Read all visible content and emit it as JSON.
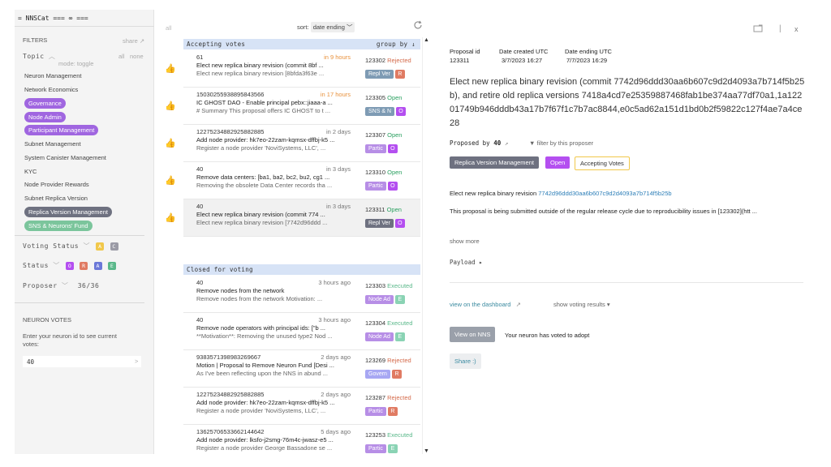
{
  "app": {
    "title": "= NNSCat === ∞ ==="
  },
  "filters": {
    "label": "FILTERS",
    "share": "share ↗",
    "topic_label": "Topic",
    "topic_chevron": "︿",
    "all": "all",
    "none": "none",
    "mode": "mode: toggle",
    "topics": [
      {
        "label": "Neuron Management",
        "selected": false
      },
      {
        "label": "Network Economics",
        "selected": false
      },
      {
        "label": "Governance",
        "selected": true,
        "color": "#a066e0"
      },
      {
        "label": "Node Admin",
        "selected": true,
        "color": "#a066e0"
      },
      {
        "label": "Participant Management",
        "selected": true,
        "color": "#a066e0"
      },
      {
        "label": "Subnet Management",
        "selected": false
      },
      {
        "label": "System Canister Management",
        "selected": false
      },
      {
        "label": "KYC",
        "selected": false
      },
      {
        "label": "Node Provider Rewards",
        "selected": false
      },
      {
        "label": "Subnet Replica Version",
        "selected": false
      },
      {
        "label": "Replica Version Management",
        "selected": true,
        "color": "#6e7180"
      },
      {
        "label": "SNS & Neurons' Fund",
        "selected": true,
        "color": "#7bc59c"
      }
    ],
    "voting_status": {
      "label": "Voting Status",
      "chevron": "﹀",
      "badges": [
        "A",
        "C"
      ]
    },
    "status": {
      "label": "Status",
      "chevron": "﹀",
      "badges": [
        "O",
        "R",
        "A",
        "E"
      ]
    },
    "proposer": {
      "label": "Proposer",
      "chevron": "﹀",
      "count": "36/36"
    }
  },
  "neuron_votes": {
    "label": "NEURON VOTES",
    "help": "Enter your neuron id to see current votes:",
    "value": "40",
    "arrow": ">"
  },
  "list": {
    "all": "all",
    "sort_label": "sort:",
    "sort_value": "date ending ﹀",
    "group_by": "group by ↓",
    "groups": [
      {
        "title": "Accepting votes"
      },
      {
        "title": "Closed for voting"
      }
    ],
    "rows": [
      {
        "proposer": "61",
        "time": "in 9 hours",
        "id": "123302",
        "status": "Rejected",
        "title": "Elect new replica binary revision (commit 8bf ...",
        "summary": "Elect new replica binary revision [8bfda3f63e ...",
        "tag": "Repl Ver",
        "sq": "R"
      },
      {
        "proposer": "15030255938895843566",
        "time": "in 17 hours",
        "id": "123305",
        "status": "Open",
        "title": "IC GHOST DAO - Enable principal pebx::jiaaa-a ...",
        "summary": "# Summary This proposal offers IC GHOST to t ...",
        "tag": "SNS & N",
        "sq": "O"
      },
      {
        "proposer": "12275234882925882885",
        "time": "in 2 days",
        "id": "123307",
        "status": "Open",
        "title": "Add node provider: hk7eo-22zam-kqmsx-dffbj-k5 ...",
        "summary": "Register a node provider 'NoviSystems, LLC', ...",
        "tag": "Partic",
        "sq": "O"
      },
      {
        "proposer": "40",
        "time": "in 3 days",
        "id": "123310",
        "status": "Open",
        "title": "Remove data centers: [ba1, ba2, bc2, bu2, cg1 ...",
        "summary": "Removing the obsolete Data Center records tha ...",
        "tag": "Partic",
        "sq": "O"
      },
      {
        "proposer": "40",
        "time": "in 3 days",
        "id": "123311",
        "status": "Open",
        "title": "Elect new replica binary revision (commit 774 ...",
        "summary": "Elect new replica binary revision [7742d96ddd ...",
        "tag": "Repl Ver",
        "sq": "O"
      },
      {
        "proposer": "40",
        "time": "3 hours ago",
        "id": "123303",
        "status": "Executed",
        "title": "Remove nodes from the network",
        "summary": "Remove nodes from the network Motivation: ...",
        "tag": "Node Ad",
        "sq": "E"
      },
      {
        "proposer": "40",
        "time": "3 hours ago",
        "id": "123304",
        "status": "Executed",
        "title": "Remove node operators with principal ids: [\"b ...",
        "summary": "**Motivation**: Removing the unused type2 Nod ...",
        "tag": "Node Ad",
        "sq": "E"
      },
      {
        "proposer": "9383571398983269667",
        "time": "2 days ago",
        "id": "123269",
        "status": "Rejected",
        "title": "Motion | Proposal to Remove Neuron Fund [Desi ...",
        "summary": "As I've been reflecting upon the NNS in abund ...",
        "tag": "Govern",
        "sq": "R"
      },
      {
        "proposer": "12275234882925882885",
        "time": "2 days ago",
        "id": "123287",
        "status": "Rejected",
        "title": "Add node provider: hk7eo-22zam-kqmsx-dffbj-k5 ...",
        "summary": "Register a node provider 'NoviSystems, LLC', ...",
        "tag": "Partic",
        "sq": "R"
      },
      {
        "proposer": "13625706533662144642",
        "time": "5 days ago",
        "id": "123253",
        "status": "Executed",
        "title": "Add node provider: lksfo-j2smg-76m4c-jwasz-e5 ...",
        "summary": "Register a node provider George Bassadone se ...",
        "tag": "Partic",
        "sq": "E"
      }
    ]
  },
  "detail": {
    "proposal_id_label": "Proposal id",
    "proposal_id": "123311",
    "created_label": "Date created UTC",
    "created": "3/7/2023 16:27",
    "ending_label": "Date ending UTC",
    "ending": "7/7/2023 16:29",
    "title": "Elect new replica binary revision (commit 7742d96ddd30aa6b607c9d2d4093a7b714f5b25b), and retire old replica versions 7418a4cd7e25359887468fab1be374aa77df70a1,1a12201749b946dddb43a17b7f67f1c7b7ac8844,e0c5ad62a151d1bd0b2f59822c127f4ae7a4ce28",
    "proposed_by_label": "Proposed by",
    "proposed_by": "40",
    "filter_proposer": "filter by this proposer",
    "tags": [
      "Replica Version Management",
      "Open",
      "Accepting Votes"
    ],
    "summary_prefix": "Elect new replica binary revision",
    "summary_link": "7742d96ddd30aa6b607c9d2d4093a7b714f5b25b",
    "body": "This proposal is being submitted outside of the regular release cycle due to reproducibility issues in [123302](htt ...",
    "show_more": "show more",
    "payload": "Payload ▸",
    "dashboard_link": "view on the dashboard",
    "voting_results": "show voting results ▾",
    "view_nns": "View on NNS",
    "vote_note": "Your neuron has voted to adopt",
    "share": "Share :)",
    "window_controls": {
      "separator": "|",
      "close": "x"
    }
  }
}
